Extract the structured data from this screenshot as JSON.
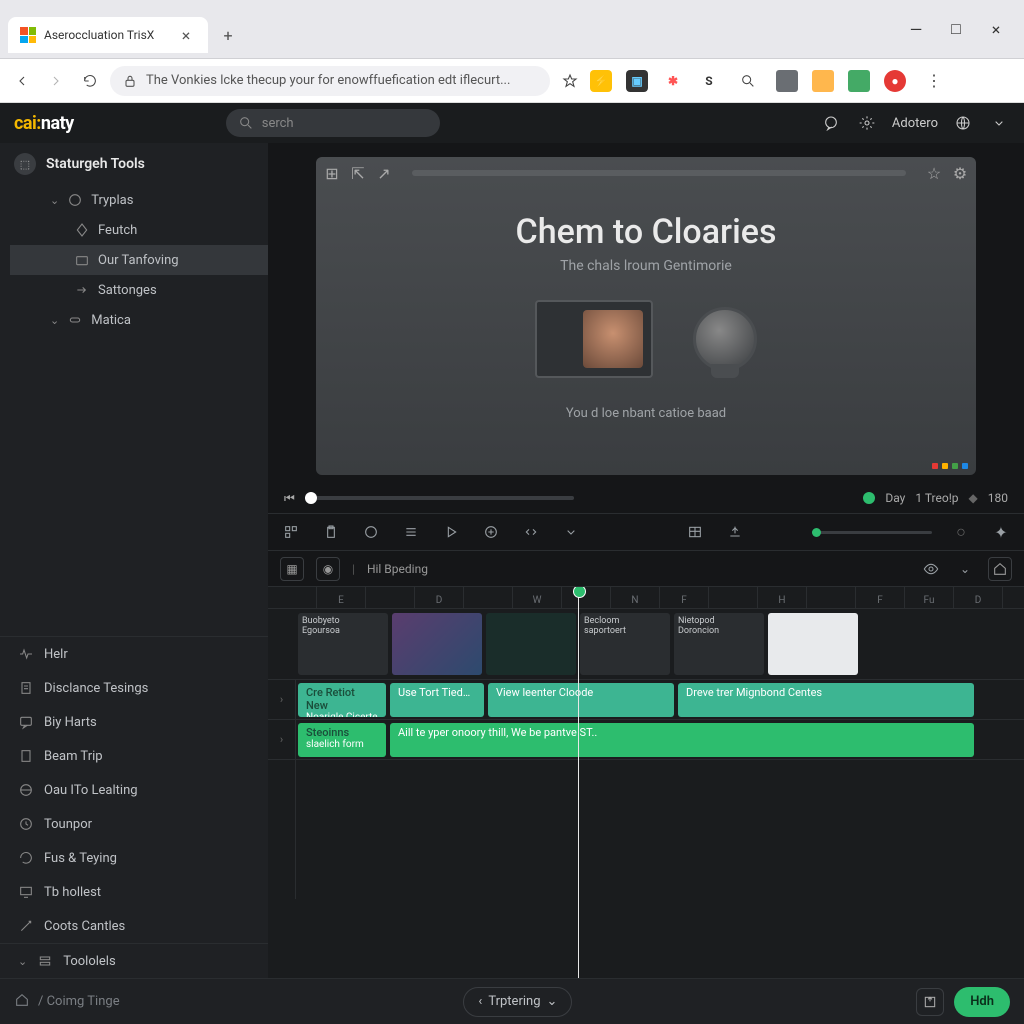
{
  "browser": {
    "tab_title": "Aseroccluation TrisX",
    "url_text": "The Vonkies lcke thecup your for enowffuefication edt iflecurt...",
    "ext_s": "S"
  },
  "header": {
    "logo_a": "cai:",
    "logo_b": "naty",
    "search_placeholder": "serch",
    "user": "Adotero"
  },
  "sidebar": {
    "title": "Staturgeh Tools",
    "tree": {
      "root": "Tryplas",
      "item1": "Feutch",
      "item2": "Our Tanfoving",
      "item3": "Sattonges",
      "item4": "Matica"
    },
    "lower": [
      "Helr",
      "Disclance Tesings",
      "Biy Harts",
      "Beam Trip",
      "Oau ITo Lealting",
      "Tounpor",
      "Fus & Teying",
      "Tb hollest",
      "Coots Cantles",
      "Toololels"
    ]
  },
  "preview": {
    "title": "Chem to Cloaries",
    "subtitle": "The chals lroum Gentimorie",
    "footer": "You d loe nbant catioe baad"
  },
  "scrubber": {
    "day": "Day",
    "treo": "1 Treo!p",
    "val": "180"
  },
  "subbar": {
    "label": "Hil Bpeding"
  },
  "ruler": [
    "",
    "E",
    "",
    "D",
    "",
    "W",
    "",
    "N",
    "F",
    "",
    "H",
    "",
    "F",
    "Fu",
    "D"
  ],
  "clips": [
    {
      "name_a": "Buobyeto",
      "name_b": "Egoursoa"
    },
    {
      "name_a": "",
      "name_b": ""
    },
    {
      "name_a": "",
      "name_b": ""
    },
    {
      "name_a": "Becloom",
      "name_b": "saportoert"
    },
    {
      "name_a": "Nietopod",
      "name_b": "Doroncion"
    },
    {
      "name_a": "",
      "name_b": ""
    }
  ],
  "track1": {
    "a_title": "Cre Retiot New",
    "a_sub": "Noarigle Cicerte",
    "b": "Use Tort Tied…",
    "c": "View leenter Cloode",
    "d": "Dreve trer Mignbond Centes"
  },
  "track2": {
    "a_title": "Steoinns",
    "a_sub": "slaelich form",
    "b": "Aill te yper onoory thill, We be pantve ST.."
  },
  "footerbar": {
    "left": "/ Coimg Tinge",
    "center": "Trptering",
    "btn": "Hdh"
  }
}
